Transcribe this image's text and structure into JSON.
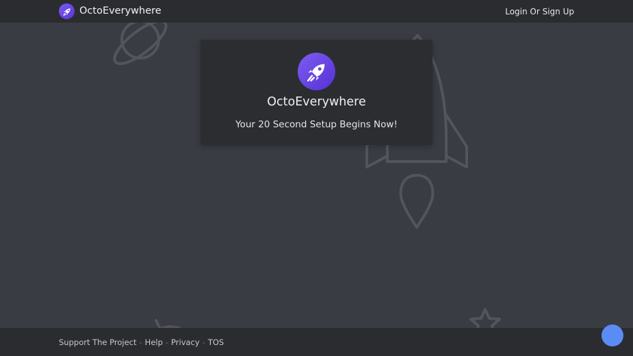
{
  "header": {
    "brand_name": "OctoEverywhere",
    "login_label": "Login Or Sign Up"
  },
  "card": {
    "title": "OctoEverywhere",
    "subtitle": "Your 20 Second Setup Begins Now!"
  },
  "footer": {
    "links": [
      {
        "label": "Support The Project"
      },
      {
        "label": "Help"
      },
      {
        "label": "Privacy"
      },
      {
        "label": "TOS"
      }
    ],
    "separator": "-"
  },
  "icons": {
    "brand_logo": "rocket-icon",
    "card_logo": "rocket-icon",
    "background": [
      "planet-icon",
      "rocket-outline-icon",
      "star-icon"
    ],
    "chat": "chat-bubble-icon"
  },
  "colors": {
    "background": "#393c42",
    "bar": "#2b2c30",
    "card": "#2c2d31",
    "brand_purple": "#6a44e3",
    "chat_blue": "#5b8cf5"
  }
}
